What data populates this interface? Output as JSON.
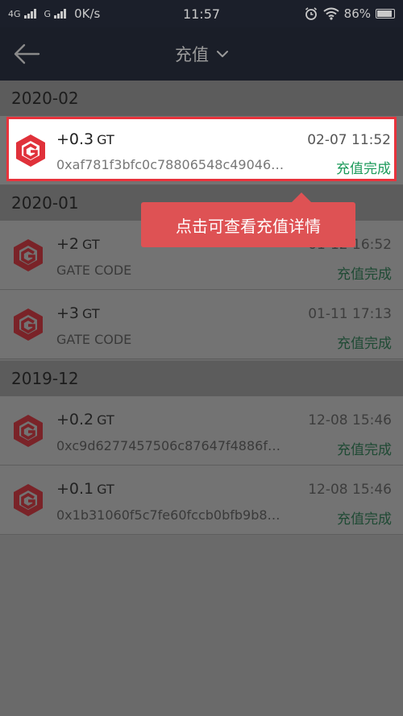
{
  "status_bar": {
    "network_1": "4G",
    "network_2": "G",
    "speed": "0K/s",
    "time": "11:57",
    "battery": "86%"
  },
  "app_bar": {
    "back_icon": "back-arrow-icon",
    "title": "充值"
  },
  "sections": [
    {
      "month": "2020-02",
      "items": [
        {
          "amount": "+0.3",
          "unit": "GT",
          "sub": "0xaf781f3bfc0c78806548c49046…",
          "date": "02-07 11:52",
          "status": "充值完成"
        }
      ]
    },
    {
      "month": "2020-01",
      "items": [
        {
          "amount": "+2",
          "unit": "GT",
          "sub": "GATE CODE",
          "date": "01-12 16:52",
          "status": "充值完成"
        },
        {
          "amount": "+3",
          "unit": "GT",
          "sub": "GATE CODE",
          "date": "01-11 17:13",
          "status": "充值完成"
        }
      ]
    },
    {
      "month": "2019-12",
      "items": [
        {
          "amount": "+0.2",
          "unit": "GT",
          "sub": "0xc9d6277457506c87647f4886f…",
          "date": "12-08 15:46",
          "status": "充值完成"
        },
        {
          "amount": "+0.1",
          "unit": "GT",
          "sub": "0x1b31060f5c7fe60fccb0bfb9b8…",
          "date": "12-08 15:46",
          "status": "充值完成"
        }
      ]
    }
  ],
  "tooltip": "点击可查看充值详情",
  "colors": {
    "accent_red": "#e8333c",
    "success_green": "#1b9a5a",
    "tooltip_bg": "#de5254"
  }
}
